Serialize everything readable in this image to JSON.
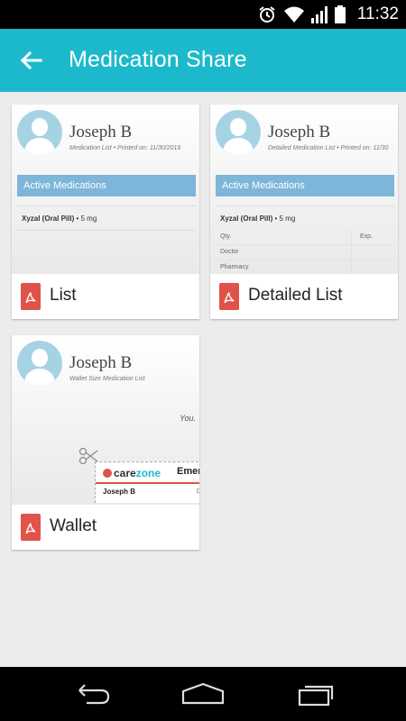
{
  "status_bar": {
    "time": "11:32",
    "icons": [
      "alarm-icon",
      "wifi-icon",
      "signal-icon",
      "battery-icon"
    ]
  },
  "app_bar": {
    "title": "Medication Share",
    "back_icon": "arrow-left-icon",
    "color": "#1cb9cc"
  },
  "cards": [
    {
      "label": "List",
      "preview": {
        "name": "Joseph B",
        "subtitle": "Medication List • Printed on: 11/30/2016",
        "section": "Active Medications",
        "med_name": "Xyzal (Oral Pill)",
        "med_dose": " • 5 mg"
      }
    },
    {
      "label": "Detailed List",
      "preview": {
        "name": "Joseph B",
        "subtitle": "Detailed Medication List • Printed on: 11/30",
        "section": "Active Medications",
        "med_name": "Xyzal (Oral Pill)",
        "med_dose": " • 5 mg",
        "rows": [
          "Qty.",
          "Doctor",
          "Pharmacy"
        ],
        "exp_label": "Exp."
      }
    },
    {
      "label": "Wallet",
      "preview": {
        "name": "Joseph B",
        "subtitle": "Wallet Size Medication List",
        "you_text": "You.",
        "brand_care": "care",
        "brand_zone": "zone",
        "emergency": "Emer",
        "card_name": "Joseph B",
        "card_d": "D"
      }
    }
  ],
  "colors": {
    "section_bar": "#7db6d8",
    "pdf_red": "#e0524a",
    "avatar": "#a6d3e3"
  },
  "nav_bar": {
    "icons": [
      "back-nav-icon",
      "home-nav-icon",
      "recents-nav-icon"
    ]
  }
}
